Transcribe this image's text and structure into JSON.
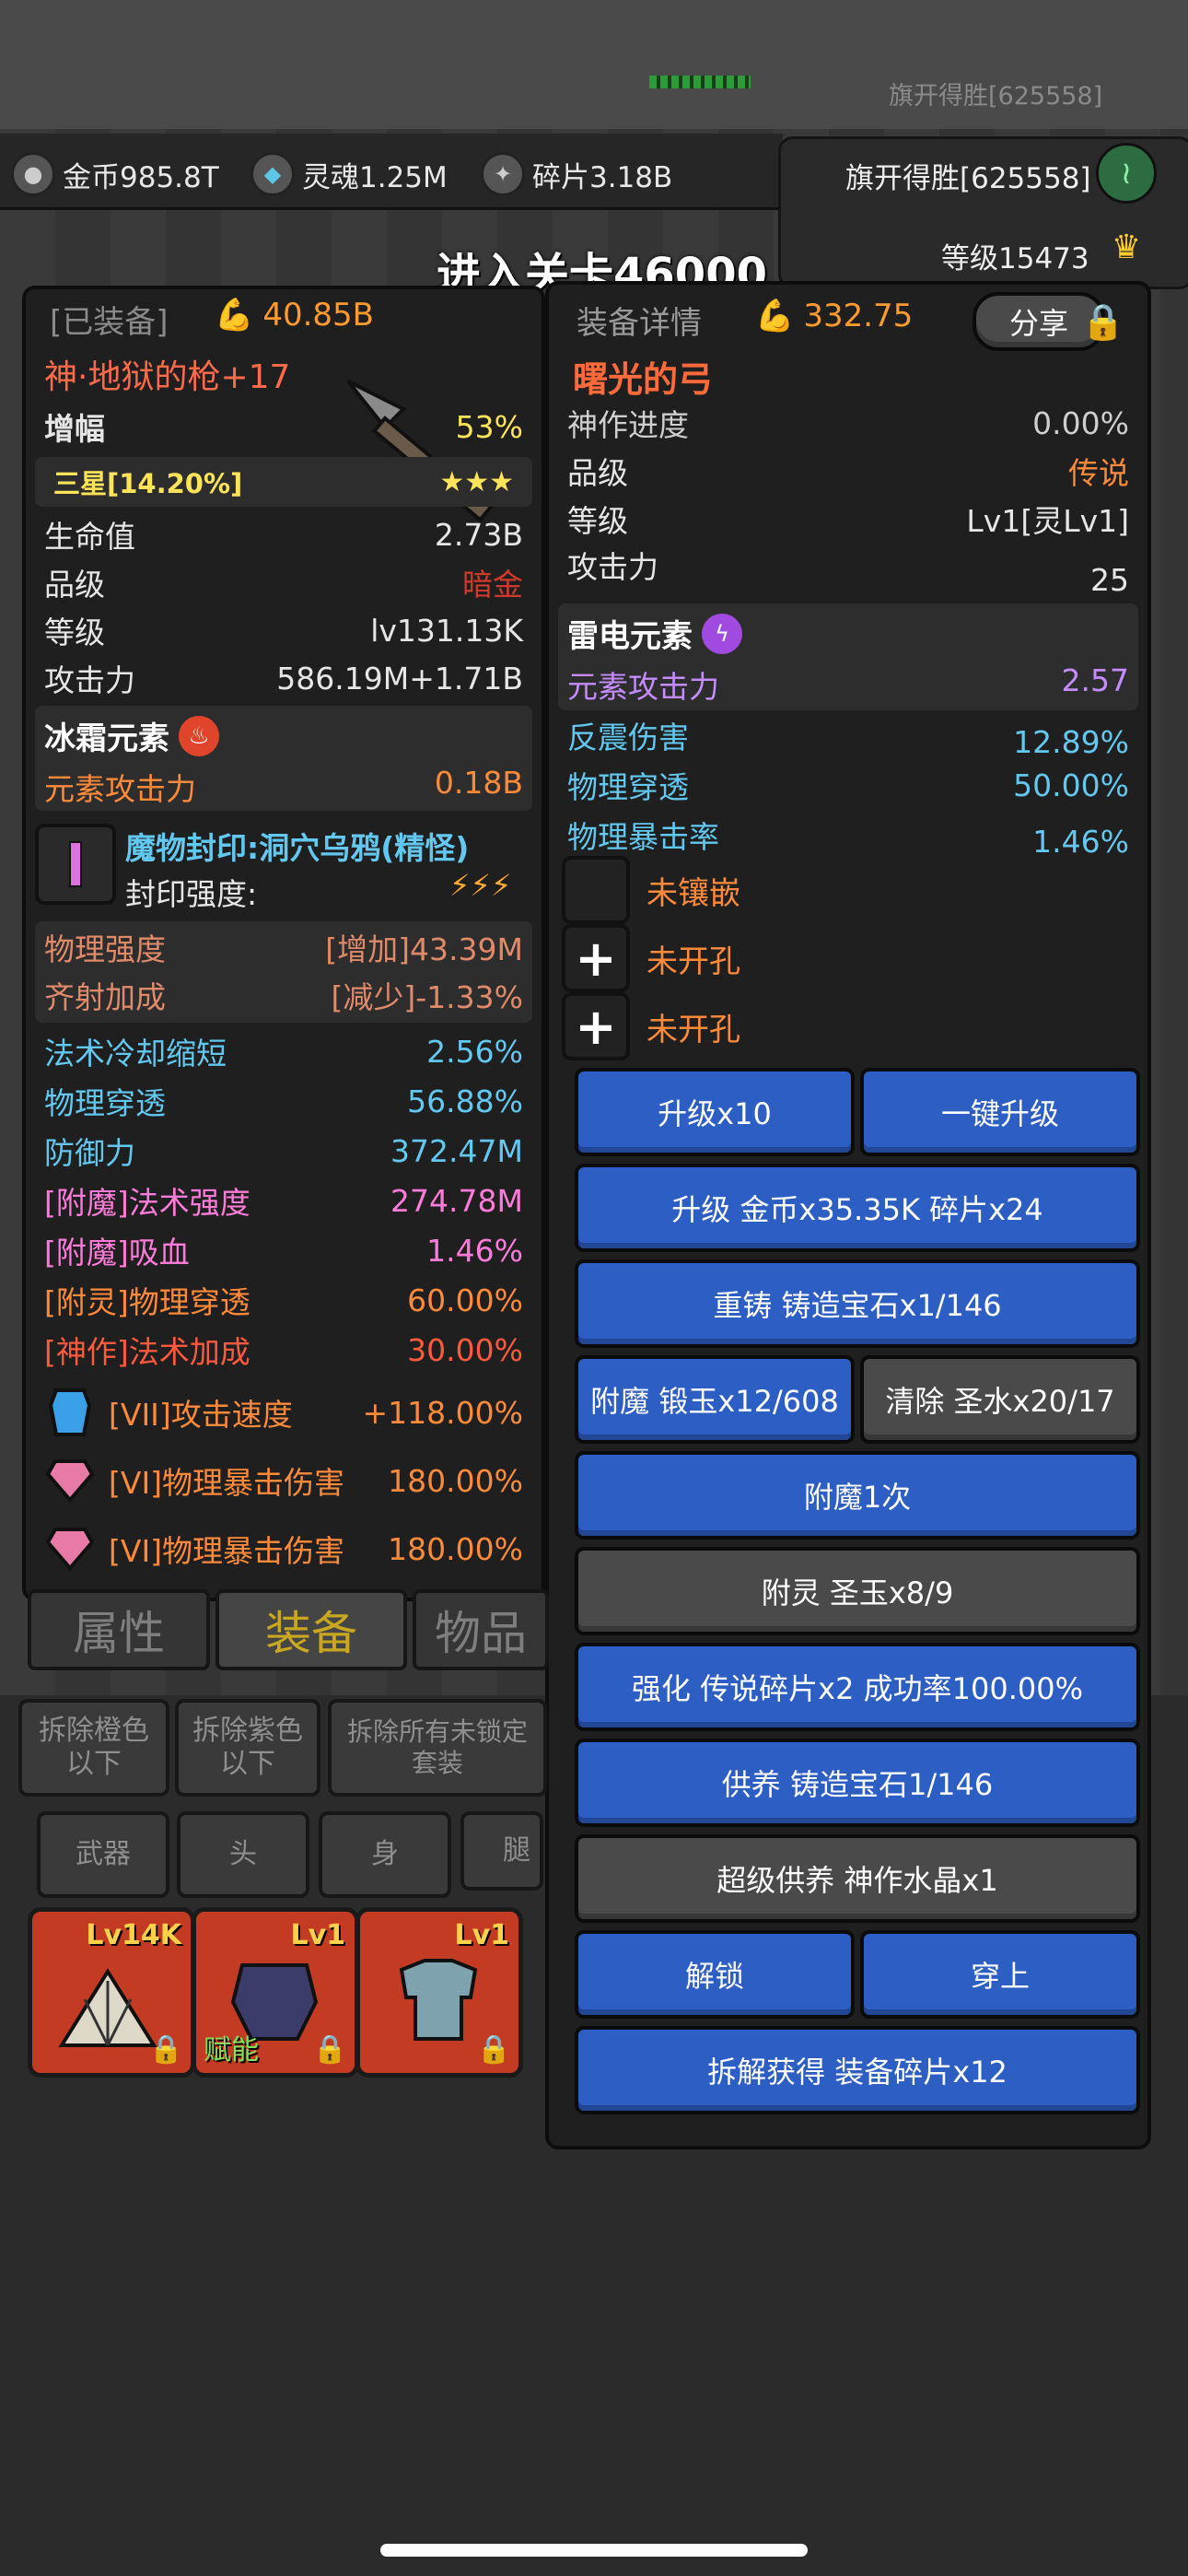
{
  "status_bar": {
    "faded_player_name": "旗开得胜[625558]"
  },
  "resources": {
    "gold": "金币985.8T",
    "soul": "灵魂1.25M",
    "shards": "碎片3.18B"
  },
  "player": {
    "name": "旗开得胜[625558]",
    "level": "等级15473"
  },
  "stage_banner": "进入关卡46000",
  "equipped_panel": {
    "header": "[已装备]",
    "power": "40.85B",
    "item_name": "神·地狱的枪+17",
    "amplify_label": "增幅",
    "amplify_value": "53%",
    "star_label": "三星[14.20%]",
    "star_count": 3,
    "stats": [
      {
        "label": "生命值",
        "value": "2.73B"
      },
      {
        "label": "品级",
        "value": "暗金"
      },
      {
        "label": "等级",
        "value": "lv131.13K"
      },
      {
        "label": "攻击力",
        "value": "586.19M+1.71B"
      }
    ],
    "element_title": "冰霜元素",
    "element_stat_label": "元素攻击力",
    "element_stat_value": "0.18B",
    "seal_title": "魔物封印:洞穴乌鸦(精怪)",
    "seal_strength_label": "封印强度:",
    "seal_stats": [
      {
        "label": "物理强度",
        "value": "[增加]43.39M"
      },
      {
        "label": "齐射加成",
        "value": "[减少]-1.33%"
      }
    ],
    "attributes": [
      {
        "label": "法术冷却缩短",
        "value": "2.56%"
      },
      {
        "label": "物理穿透",
        "value": "56.88%"
      },
      {
        "label": "防御力",
        "value": "372.47M"
      },
      {
        "label": "[附魔]法术强度",
        "value": "274.78M"
      },
      {
        "label": "[附魔]吸血",
        "value": "1.46%"
      },
      {
        "label": "[附灵]物理穿透",
        "value": "60.00%"
      },
      {
        "label": "[神作]法术加成",
        "value": "30.00%"
      }
    ],
    "gems": [
      {
        "label": "[VII]攻击速度",
        "value": "+118.00%",
        "icon": "blue-crystal-icon"
      },
      {
        "label": "[VI]物理暴击伤害",
        "value": "180.00%",
        "icon": "pink-gem-icon"
      },
      {
        "label": "[VI]物理暴击伤害",
        "value": "180.00%",
        "icon": "pink-gem-icon"
      }
    ]
  },
  "detail_panel": {
    "header": "装备详情",
    "power": "332.75",
    "share_label": "分享",
    "item_name": "曙光的弓",
    "stats": [
      {
        "label": "神作进度",
        "value": "0.00%"
      },
      {
        "label": "品级",
        "value": "传说"
      },
      {
        "label": "等级",
        "value": "Lv1[灵Lv1]"
      },
      {
        "label": "攻击力",
        "value": "25"
      }
    ],
    "element_title": "雷电元素",
    "element_stat_label": "元素攻击力",
    "element_stat_value": "2.57",
    "attributes": [
      {
        "label": "反震伤害",
        "value": "12.89%"
      },
      {
        "label": "物理穿透",
        "value": "50.00%"
      },
      {
        "label": "物理暴击率",
        "value": "1.46%"
      }
    ],
    "sockets": [
      {
        "label": "未镶嵌",
        "icon": "empty-socket-icon"
      },
      {
        "label": "未开孔",
        "icon": "plus-icon"
      },
      {
        "label": "未开孔",
        "icon": "plus-icon"
      }
    ],
    "buttons": {
      "upgrade10": "升级x10",
      "one_key_upgrade": "一键升级",
      "upgrade_cost": "升级 金币x35.35K 碎片x24",
      "recast": "重铸 铸造宝石x1/146",
      "enchant": "附魔 锻玉x12/608",
      "clear": "清除 圣水x20/17",
      "enchant_once": "附魔1次",
      "spirit": "附灵 圣玉x8/9",
      "strengthen": "强化 传说碎片x2 成功率100.00%",
      "offer": "供养 铸造宝石1/146",
      "super_offer": "超级供养 神作水晶x1",
      "unlock": "解锁",
      "wear": "穿上",
      "dismantle": "拆解获得 装备碎片x12"
    }
  },
  "tabs": [
    "属性",
    "装备",
    "物品"
  ],
  "filters": [
    "拆除橙色\n以下",
    "拆除紫色\n以下",
    "拆除所有未锁定\n套装"
  ],
  "slot_tabs": [
    "武器",
    "头",
    "身",
    "腿"
  ],
  "items": [
    {
      "level": "Lv14K",
      "icon": "fan-icon"
    },
    {
      "level": "Lv1",
      "icon": "armor-icon",
      "tag": "赋能"
    },
    {
      "level": "Lv1",
      "icon": "chest-armor-icon"
    }
  ],
  "colors": {
    "blue_button": "#2c5ec4",
    "gray_button": "#4a4a4a",
    "item_card": "#c33b22",
    "orange_text": "#ff8a3a",
    "blue_text": "#62c8f0"
  }
}
